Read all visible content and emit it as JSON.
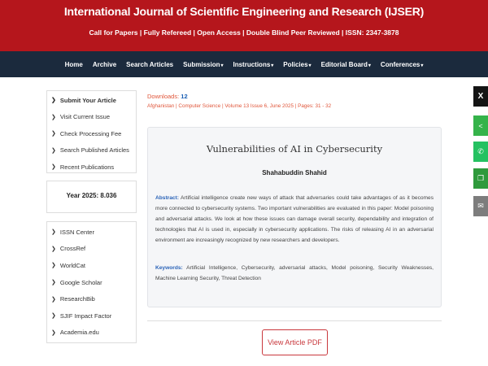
{
  "header": {
    "title": "International Journal of Scientific Engineering and Research (IJSER)",
    "subtitle": "Call for Papers | Fully Refereed | Open Access | Double Blind Peer Reviewed | ISSN: 2347-3878"
  },
  "nav": {
    "items": [
      {
        "label": "Home",
        "dropdown": false
      },
      {
        "label": "Archive",
        "dropdown": false
      },
      {
        "label": "Search Articles",
        "dropdown": false
      },
      {
        "label": "Submission",
        "dropdown": true
      },
      {
        "label": "Instructions",
        "dropdown": true
      },
      {
        "label": "Policies",
        "dropdown": true
      },
      {
        "label": "Editorial Board",
        "dropdown": true
      },
      {
        "label": "Conferences",
        "dropdown": true
      }
    ]
  },
  "sidebar": {
    "menu1": [
      {
        "label": "Submit Your Article"
      },
      {
        "label": "Visit Current Issue"
      },
      {
        "label": "Check Processing Fee"
      },
      {
        "label": "Search Published Articles"
      },
      {
        "label": "Recent Publications"
      }
    ],
    "year_label": "Year 2025: 8.036",
    "menu2": [
      {
        "label": "ISSN Center"
      },
      {
        "label": "CrossRef"
      },
      {
        "label": "WorldCat"
      },
      {
        "label": "Google Scholar"
      },
      {
        "label": "ResearchBib"
      },
      {
        "label": "SJIF Impact Factor"
      },
      {
        "label": "Academia.edu"
      }
    ]
  },
  "article": {
    "downloads_label": "Downloads: ",
    "downloads_count": "12",
    "meta": "Afghanistan | Computer Science | Volume 13 Issue 6, June 2025 | Pages: 31 - 32",
    "title": "Vulnerabilities of AI in Cybersecurity",
    "author": "Shahabuddin Shahid",
    "abstract_label": "Abstract:",
    "abstract": " Artificial intelligence create new ways of attack that adversaries could take advantages of as it becomes more connected to cybersecurity systems. Two important vulnerabilities are evaluated in this paper: Model poisoning and adversarial attacks. We look at how these issues can damage overall security, dependability and integration of technologies that AI is used in, especially in cybersecurity applications. The risks of releasing AI in an adversarial environment are increasingly recognized by new researchers and developers.",
    "keywords_label": "Keywords:",
    "keywords": " Artificial Intelligence, Cybersecurity, adversarial attacks, Model poisoning, Security Weaknesses, Machine Learning Security, Threat Detection",
    "pdf_button": "View Article PDF"
  },
  "share": {
    "x_glyph": "X",
    "share_glyph": "<",
    "whatsapp_glyph": "✆",
    "copy_glyph": "❐",
    "mail_glyph": "✉"
  }
}
